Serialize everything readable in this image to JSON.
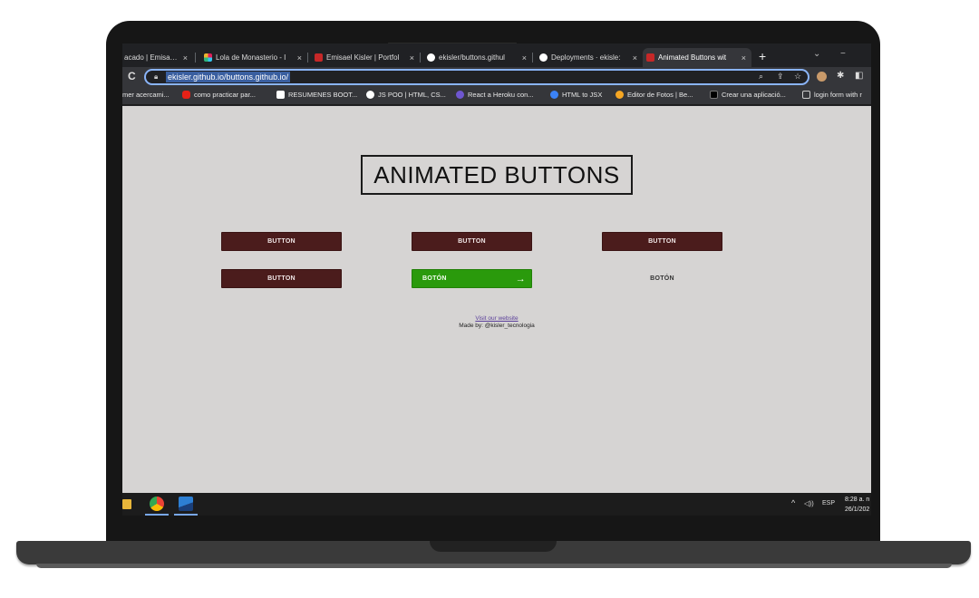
{
  "browser": {
    "tabs": [
      {
        "label": "acado | Emisael (I",
        "icon": "page-icon"
      },
      {
        "label": "Lola de Monasterio - I",
        "icon": "slack-icon"
      },
      {
        "label": "Emisael Kisler | Portfol",
        "icon": "ek-icon"
      },
      {
        "label": "ekisler/buttons.githul",
        "icon": "github-icon"
      },
      {
        "label": "Deployments · ekisle:",
        "icon": "github-icon"
      },
      {
        "label": "Animated Buttons wit",
        "icon": "ek-icon",
        "active": true
      }
    ],
    "tab_close": "×",
    "new_tab": "+",
    "reload": "C",
    "url": "ekisler.github.io/buttons.github.io/",
    "bookmarks": [
      {
        "label": "mer acercami...",
        "icon": "none"
      },
      {
        "label": "como practicar par...",
        "icon": "youtube-icon",
        "color": "#e62117"
      },
      {
        "label": "RESUMENES BOOT...",
        "icon": "notion-icon",
        "color": "#ffffff"
      },
      {
        "label": "JS POO | HTML, CS...",
        "icon": "globe-icon",
        "color": "#ffffff"
      },
      {
        "label": "React a Heroku con...",
        "icon": "heroku-icon",
        "color": "#6e56cf"
      },
      {
        "label": "HTML to JSX",
        "icon": "transform-icon",
        "color": "#3b82f6"
      },
      {
        "label": "Editor de Fotos | Be...",
        "icon": "befunky-icon",
        "color": "#f5a623"
      },
      {
        "label": "Crear una aplicació...",
        "icon": "dev-icon",
        "color": "#000000"
      },
      {
        "label": "login form with r",
        "icon": "folder-icon",
        "color": "#cccccc"
      }
    ]
  },
  "page": {
    "title": "ANIMATED BUTTONS",
    "buttons": [
      {
        "label": "BUTTON",
        "style": "maroon"
      },
      {
        "label": "BUTTON",
        "style": "maroon"
      },
      {
        "label": "BUTTON",
        "style": "maroon"
      },
      {
        "label": "BUTTON",
        "style": "maroon"
      },
      {
        "label": "BOTÓN",
        "style": "green",
        "arrow": "→"
      },
      {
        "label": "BOTÓN",
        "style": "plain"
      }
    ],
    "footer_link": "Visit our website",
    "footer_made": "Made by: @kisler_tecnologia"
  },
  "taskbar": {
    "language": "ESP",
    "time": "8:28 a. n",
    "date": "26/1/202"
  },
  "colors": {
    "page_bg": "#d6d4d3",
    "button_maroon": "#4b1c1c",
    "button_green": "#2a9a0c",
    "omnibox_focus": "#8ab4f8"
  }
}
